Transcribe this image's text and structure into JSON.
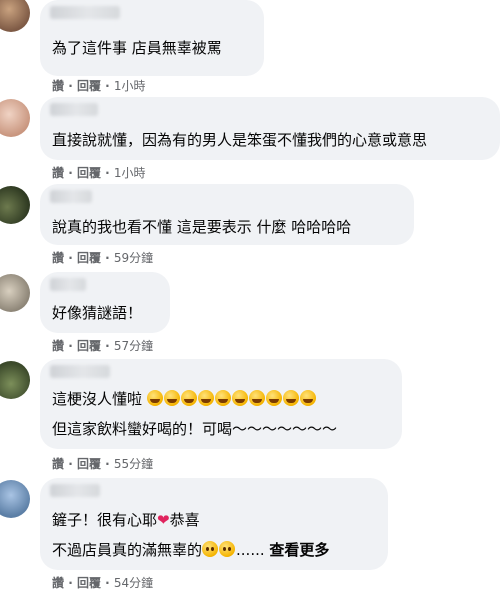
{
  "meta_labels": {
    "like": "讚",
    "reply": "回覆",
    "sep": " · "
  },
  "colors": {
    "bubble": "#f0f2f5",
    "meta_text": "#65676b",
    "heart": "#e0245e"
  },
  "comments": [
    {
      "text": "為了這件事 店員無辜被罵",
      "time": "1小時"
    },
    {
      "text": "直接說就懂，因為有的男人是笨蛋不懂我們的心意或意思",
      "time": "1小時"
    },
    {
      "text": "說真的我也看不懂 這是要表示 什麼 哈哈哈哈",
      "time": "59分鐘"
    },
    {
      "text": "好像猜謎語！",
      "time": "57分鐘"
    },
    {
      "line1": "這梗沒人懂啦",
      "line2": "但這家飲料蠻好喝的！可喝～～～～～～～",
      "time": "55分鐘",
      "emoji": "face-with-tears-of-joy-icon"
    },
    {
      "line1_a": "鏟子！很有心耶",
      "line1_b": "恭喜",
      "line2": "不過店員真的滿無辜的",
      "ellipsis": "......",
      "see_more": "查看更多",
      "time": "54分鐘"
    }
  ]
}
